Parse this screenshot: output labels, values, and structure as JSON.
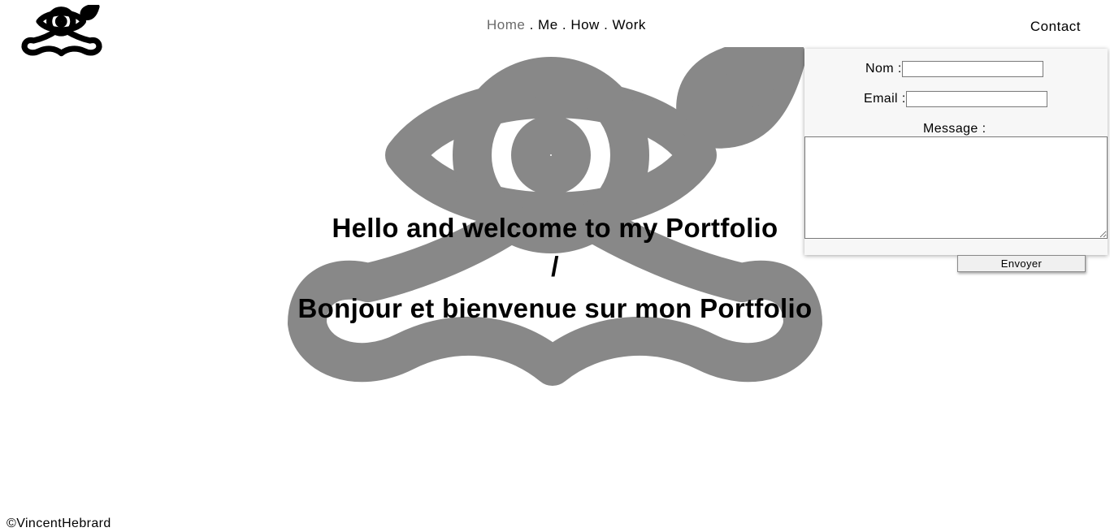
{
  "nav": {
    "items": [
      {
        "label": "Home",
        "active": true
      },
      {
        "label": "Me",
        "active": false
      },
      {
        "label": "How",
        "active": false
      },
      {
        "label": "Work",
        "active": false
      }
    ],
    "separator": " . ",
    "contact": "Contact"
  },
  "hero": {
    "line1": "Hello and welcome to my Portfolio",
    "line2": "/",
    "line3": "Bonjour et bienvenue sur mon Portfolio"
  },
  "contact_form": {
    "name_label": "Nom :",
    "name_value": "",
    "email_label": "Email :",
    "email_value": "",
    "message_label": "Message :",
    "message_value": "",
    "submit_label": "Envoyer"
  },
  "footer": {
    "copyright": "©VincentHebrard"
  },
  "colors": {
    "background": "#ffffff",
    "logo_watermark": "#888888",
    "nav_active": "#6a6a6a",
    "panel_background": "#f7f7f7"
  },
  "icons": {
    "logo": "eye-mustache-leaf-logo-icon",
    "watermark": "eye-mustache-leaf-watermark-icon"
  }
}
